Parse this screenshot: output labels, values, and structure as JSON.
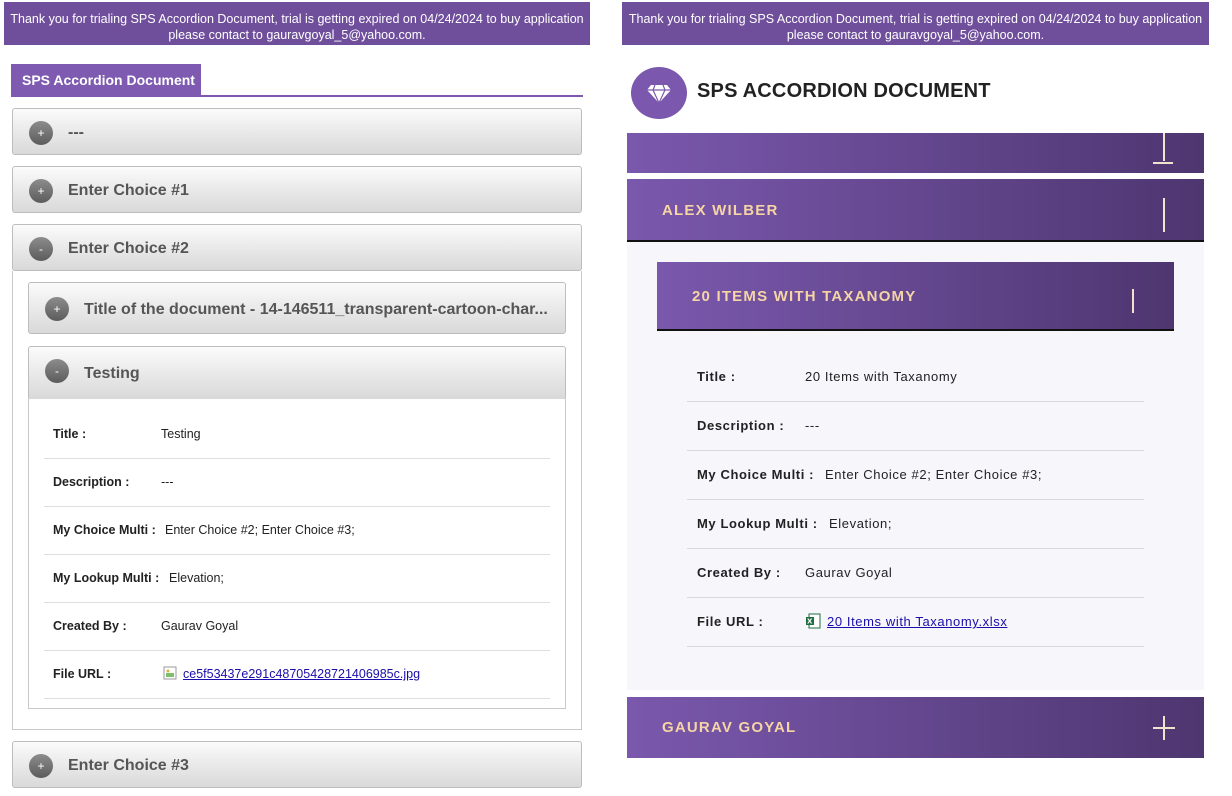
{
  "trial_banner": {
    "line1": "Thank you for trialing SPS Accordion Document, trial is getting expired on 04/24/2024 to buy application",
    "line2": "please contact to gauravgoyal_5@yahoo.com."
  },
  "left": {
    "tab_title": "SPS Accordion Document",
    "sections": [
      {
        "label": "---",
        "state": "+"
      },
      {
        "label": "Enter Choice #1",
        "state": "+"
      },
      {
        "label": "Enter Choice #2",
        "state": "-"
      },
      {
        "label": "Enter Choice #3",
        "state": "+"
      }
    ],
    "sub_sections": [
      {
        "label": "Title of the document - 14-146511_transparent-cartoon-char...",
        "state": "+"
      },
      {
        "label": "Testing",
        "state": "-"
      }
    ],
    "details": [
      {
        "key": "Title :",
        "value": "Testing"
      },
      {
        "key": "Description :",
        "value": "---"
      },
      {
        "key": "My Choice Multi :",
        "value": "Enter Choice #2; Enter Choice #3;"
      },
      {
        "key": "My Lookup Multi :",
        "value": "Elevation;"
      },
      {
        "key": "Created By :",
        "value": "Gaurav Goyal"
      },
      {
        "key": "File URL :",
        "value": "ce5f53437e291c48705428721406985c.jpg"
      }
    ]
  },
  "right": {
    "title": "SPS ACCORDION DOCUMENT",
    "groups": [
      {
        "label": "",
        "state": "collapse"
      },
      {
        "label": "ALEX WILBER",
        "state": "expanded"
      },
      {
        "label": "GAURAV GOYAL",
        "state": "collapsed"
      }
    ],
    "sub_group": {
      "label": "20 ITEMS WITH TAXANOMY"
    },
    "details": [
      {
        "key": "Title :",
        "value": "20 Items with Taxanomy"
      },
      {
        "key": "Description :",
        "value": "---"
      },
      {
        "key": "My Choice Multi :",
        "value": "Enter Choice #2; Enter Choice #3;"
      },
      {
        "key": "My Lookup Multi :",
        "value": "Elevation;"
      },
      {
        "key": "Created By :",
        "value": "Gaurav Goyal"
      },
      {
        "key": "File URL :",
        "value": "20 Items with Taxanomy.xlsx"
      }
    ]
  },
  "colors": {
    "accent": "#7e5bb0",
    "banner": "#6f4f9b",
    "header_text": "#f6d4a6"
  }
}
